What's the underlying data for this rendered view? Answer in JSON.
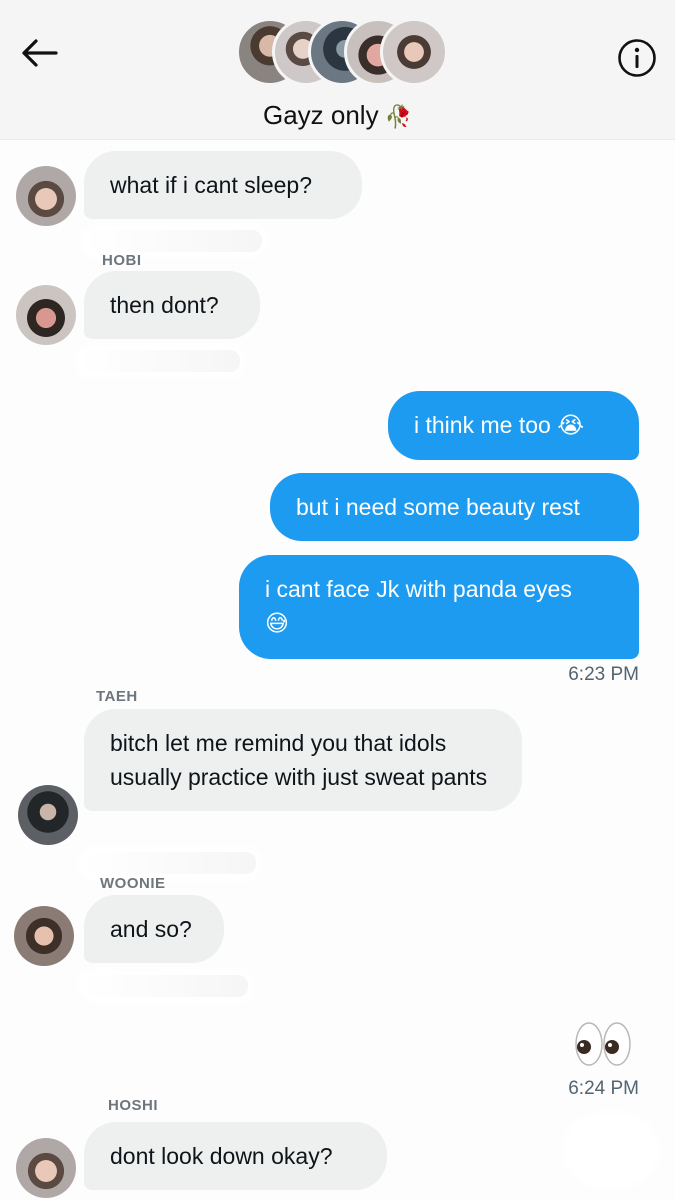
{
  "header": {
    "title": "Gayz only",
    "title_emoji": "🥀",
    "back_icon": "arrow-left-icon",
    "info_icon": "info-circle-icon",
    "participants": [
      {
        "name": "participant-1",
        "color": "#7a6a5e"
      },
      {
        "name": "participant-2",
        "color": "#b8a8a0"
      },
      {
        "name": "participant-3",
        "color": "#3d4a57"
      },
      {
        "name": "participant-4",
        "color": "#9a7868"
      },
      {
        "name": "participant-5",
        "color": "#c9b9b0"
      }
    ]
  },
  "messages": [
    {
      "direction": "in",
      "text": "what if i cant sleep?"
    },
    {
      "direction": "in",
      "sender": "HOBI",
      "text": "then dont?"
    },
    {
      "direction": "out",
      "text": "i think me too",
      "emoji": "😭"
    },
    {
      "direction": "out",
      "text": "but i need some beauty rest"
    },
    {
      "direction": "out",
      "text": "i cant face Jk with panda eyes",
      "emoji": "😅",
      "time": "6:23 PM"
    },
    {
      "direction": "in",
      "sender": "TAEH",
      "text": "bitch let me remind you that idols usually practice with just sweat pants"
    },
    {
      "direction": "in",
      "sender": "WOONIE",
      "text": "and so?"
    },
    {
      "direction": "out",
      "emoji": "👀",
      "time": "6:24 PM"
    },
    {
      "direction": "in",
      "sender": "HOSHI",
      "text": "dont look down okay?"
    }
  ],
  "colors": {
    "accent": "#1d9bf0",
    "incoming_bubble": "#eef0f0",
    "header_bg": "#f5f5f5"
  }
}
